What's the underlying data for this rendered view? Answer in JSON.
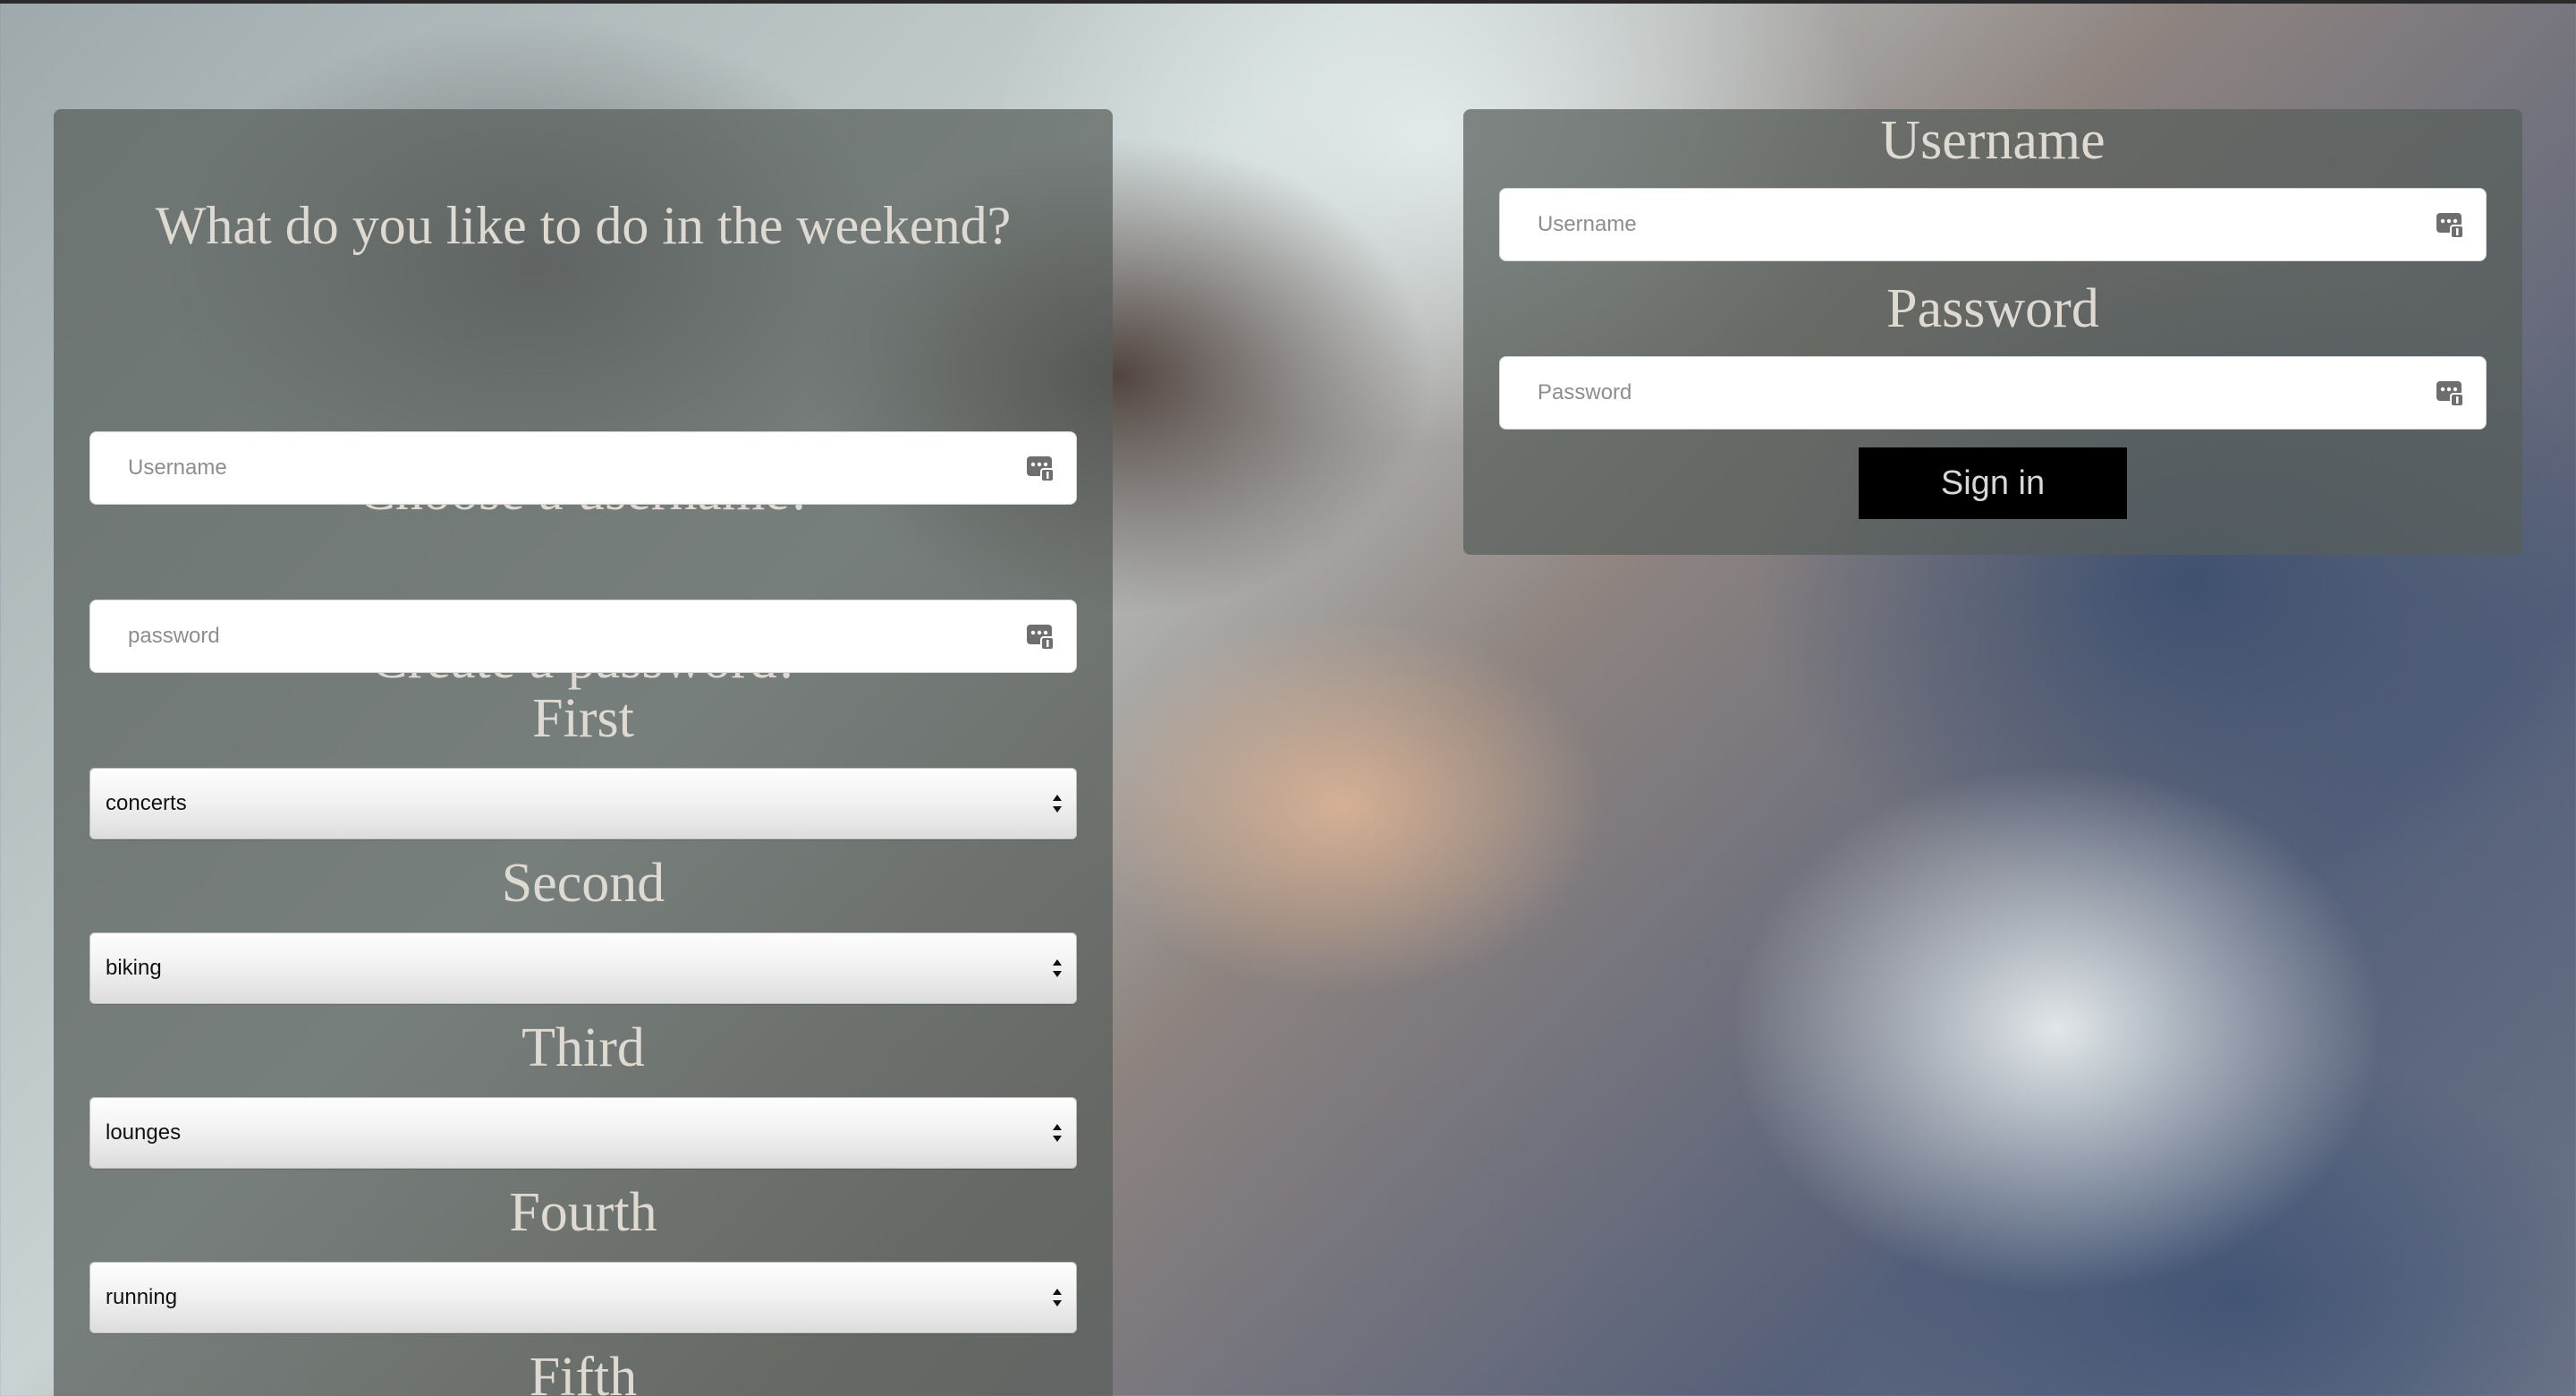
{
  "signup": {
    "question": "What do you like to do in the weekend?",
    "username_label": "Choose a username!",
    "username_placeholder": "Username",
    "password_label": "Create a password!",
    "password_placeholder": "password",
    "preferences": [
      {
        "label": "First",
        "selected": "concerts"
      },
      {
        "label": "Second",
        "selected": "biking"
      },
      {
        "label": "Third",
        "selected": "lounges"
      },
      {
        "label": "Fourth",
        "selected": "running"
      },
      {
        "label": "Fifth",
        "selected": ""
      }
    ]
  },
  "signin": {
    "username_label": "Username",
    "username_placeholder": "Username",
    "password_label": "Password",
    "password_placeholder": "Password",
    "button_label": "Sign in"
  },
  "icons": {
    "field_autofill": "key-autofill-icon",
    "select_arrows": "select-arrows-icon"
  },
  "colors": {
    "panel_overlay": "#585e5a",
    "heading_text": "#dedad2",
    "signin_button": "#000000"
  }
}
